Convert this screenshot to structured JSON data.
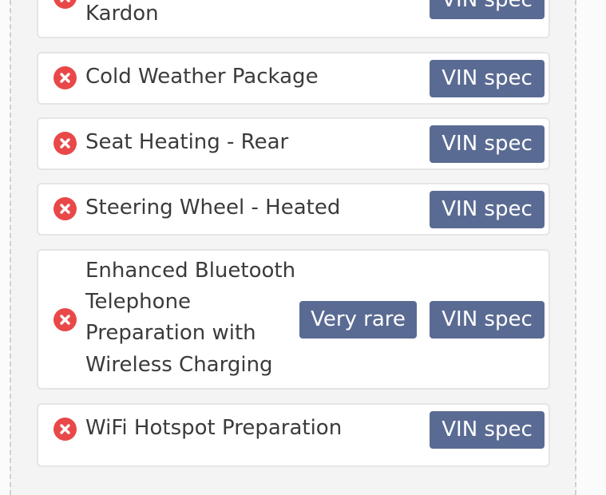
{
  "features": [
    {
      "label_lines": [
        "Kardon"
      ],
      "vin": "VIN spec"
    },
    {
      "label_lines": [
        "Cold Weather Package"
      ],
      "vin": "VIN spec"
    },
    {
      "label_lines": [
        "Seat Heating - Rear"
      ],
      "vin": "VIN spec"
    },
    {
      "label_lines": [
        "Steering Wheel - Heated"
      ],
      "vin": "VIN spec"
    },
    {
      "label_lines": [
        "Enhanced Bluetooth",
        "Telephone",
        "Preparation with",
        "Wireless Charging"
      ],
      "rare": "Very rare",
      "vin": "VIN spec"
    },
    {
      "label_lines": [
        "WiFi Hotspot Preparation"
      ],
      "vin": "VIN spec"
    }
  ],
  "colors": {
    "accent": "#5a6b93",
    "status_missing": "#e94848"
  },
  "icons": {
    "status": "x-circle-icon"
  }
}
